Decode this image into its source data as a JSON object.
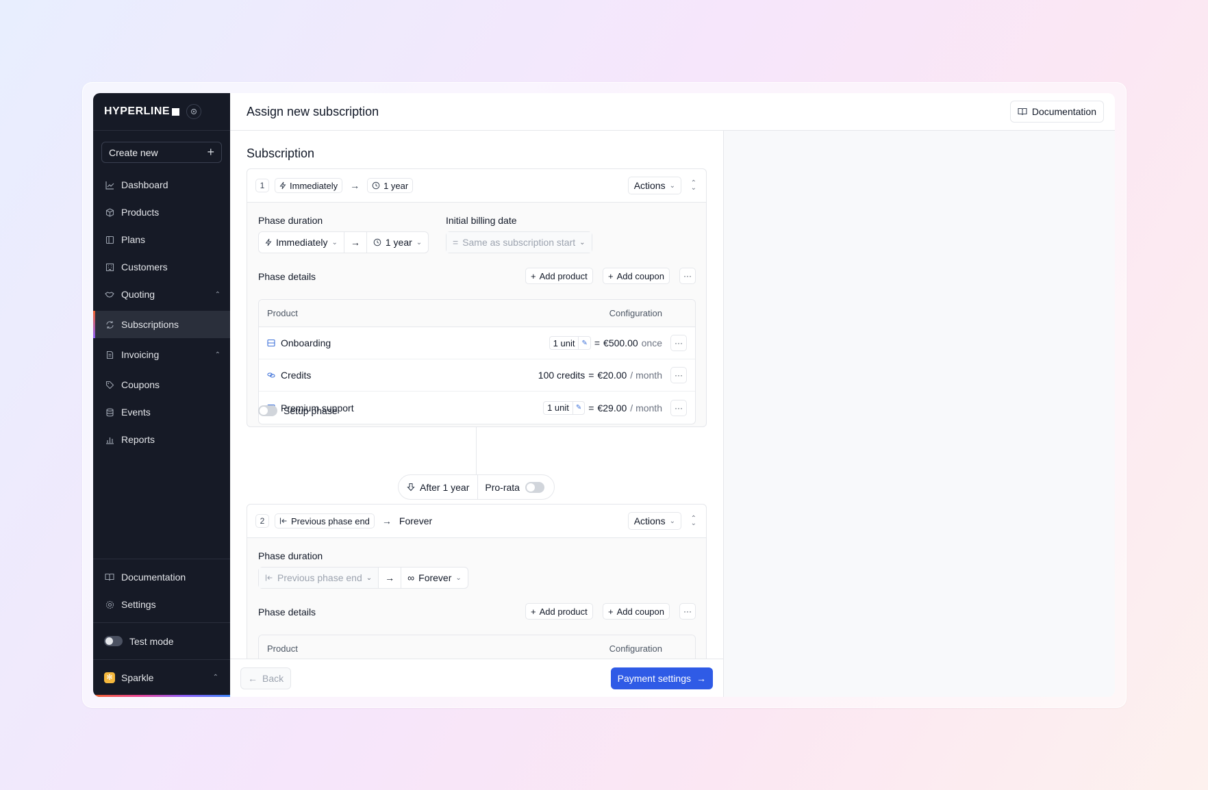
{
  "brand": {
    "name": "HYPERLINE"
  },
  "sidebar": {
    "create_new": "Create new",
    "items": [
      {
        "label": "Dashboard",
        "icon": "chart-line-icon"
      },
      {
        "label": "Products",
        "icon": "box-icon"
      },
      {
        "label": "Plans",
        "icon": "columns-icon"
      },
      {
        "label": "Customers",
        "icon": "building-icon"
      },
      {
        "label": "Quoting",
        "icon": "handshake-icon"
      },
      {
        "label": "Subscriptions",
        "icon": "refresh-icon",
        "active": true
      },
      {
        "label": "Invoicing",
        "icon": "receipt-icon"
      },
      {
        "label": "Coupons",
        "icon": "tag-icon"
      },
      {
        "label": "Events",
        "icon": "database-icon"
      },
      {
        "label": "Reports",
        "icon": "bar-chart-icon"
      }
    ],
    "bottom": [
      {
        "label": "Documentation",
        "icon": "book-icon"
      },
      {
        "label": "Settings",
        "icon": "gear-icon"
      }
    ],
    "test_mode": "Test mode",
    "workspace": "Sparkle"
  },
  "header": {
    "title": "Assign new subscription",
    "doc_button": "Documentation"
  },
  "form": {
    "section_title": "Subscription",
    "phases": [
      {
        "number": "1",
        "start": "Immediately",
        "end": "1 year",
        "actions": "Actions",
        "phase_duration_label": "Phase duration",
        "initial_billing_label": "Initial billing date",
        "initial_billing_value": "Same as subscription start",
        "phase_details_label": "Phase details",
        "add_product": "Add product",
        "add_coupon": "Add coupon",
        "table": {
          "col_product": "Product",
          "col_config": "Configuration",
          "rows": [
            {
              "name": "Onboarding",
              "qty": "1 unit",
              "equals": "=",
              "price": "€500.00",
              "period": "once"
            },
            {
              "name": "Credits",
              "qty": "100 credits",
              "equals": "=",
              "price": "€20.00",
              "period": "/ month"
            },
            {
              "name": "Premium support",
              "qty": "1 unit",
              "equals": "=",
              "price": "€29.00",
              "period": "/ month"
            }
          ]
        },
        "setup_phase": "Setup phase"
      },
      {
        "number": "2",
        "start": "Previous phase end",
        "end": "Forever",
        "actions": "Actions",
        "phase_duration_label": "Phase duration",
        "phase_details_label": "Phase details",
        "add_product": "Add product",
        "add_coupon": "Add coupon",
        "table": {
          "col_product": "Product",
          "col_config": "Configuration"
        }
      }
    ],
    "transition": {
      "after": "After 1 year",
      "prorata": "Pro-rata"
    }
  },
  "footer": {
    "back": "Back",
    "next": "Payment settings"
  },
  "colors": {
    "sidebar_bg": "#161a26",
    "primary": "#2f5be6",
    "accent_icon": "#3b6fd8"
  }
}
